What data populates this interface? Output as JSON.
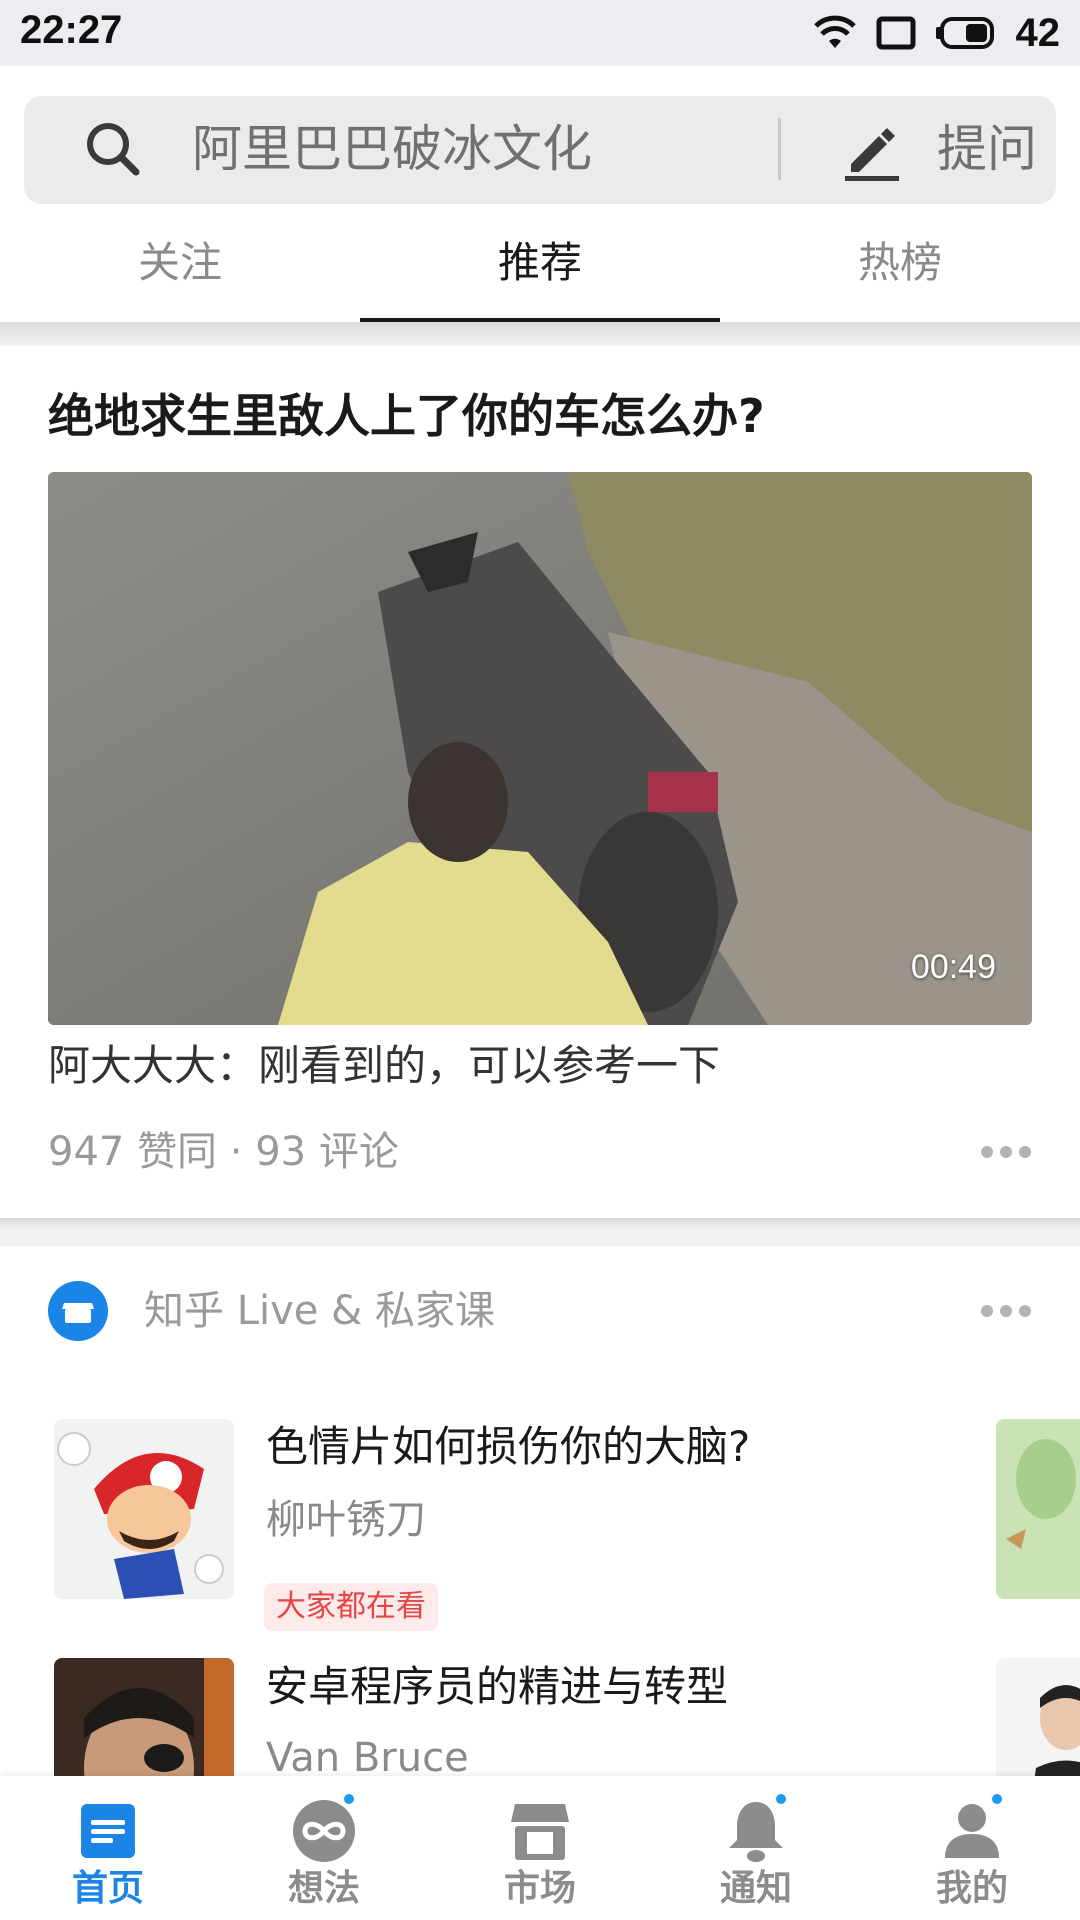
{
  "status_bar": {
    "time": "22:27",
    "battery_percent": "42",
    "icons": [
      "wifi-icon",
      "screen-icon",
      "battery-icon"
    ]
  },
  "search": {
    "placeholder": "阿里巴巴破冰文化",
    "ask_label": "提问",
    "icons": [
      "search-icon",
      "pencil-icon"
    ]
  },
  "tabs": [
    {
      "label": "关注",
      "active": false
    },
    {
      "label": "推荐",
      "active": true
    },
    {
      "label": "热榜",
      "active": false
    }
  ],
  "feed_card": {
    "title": "绝地求生里敌人上了你的车怎么办?",
    "video_duration": "00:49",
    "excerpt": "阿大大大：刚看到的，可以参考一下",
    "meta": "947 赞同 · 93 评论"
  },
  "live_section": {
    "title": "知乎 Live & 私家课",
    "items": [
      {
        "title": "色情片如何损伤你的大脑?",
        "author": "柳叶锈刀",
        "badge": "大家都在看"
      },
      {
        "title": "安卓程序员的精进与转型",
        "author": "Van Bruce"
      }
    ]
  },
  "bottom_nav": [
    {
      "label": "首页",
      "icon": "home-icon",
      "active": true,
      "dot": false
    },
    {
      "label": "想法",
      "icon": "ideas-icon",
      "active": false,
      "dot": true
    },
    {
      "label": "市场",
      "icon": "market-icon",
      "active": false,
      "dot": false
    },
    {
      "label": "通知",
      "icon": "bell-icon",
      "active": false,
      "dot": true
    },
    {
      "label": "我的",
      "icon": "profile-icon",
      "active": false,
      "dot": true
    }
  ],
  "colors": {
    "accent": "#1a85e6",
    "badge_text": "#e64545",
    "badge_bg": "#fdeaea",
    "notification_dot": "#1a9bf0"
  }
}
